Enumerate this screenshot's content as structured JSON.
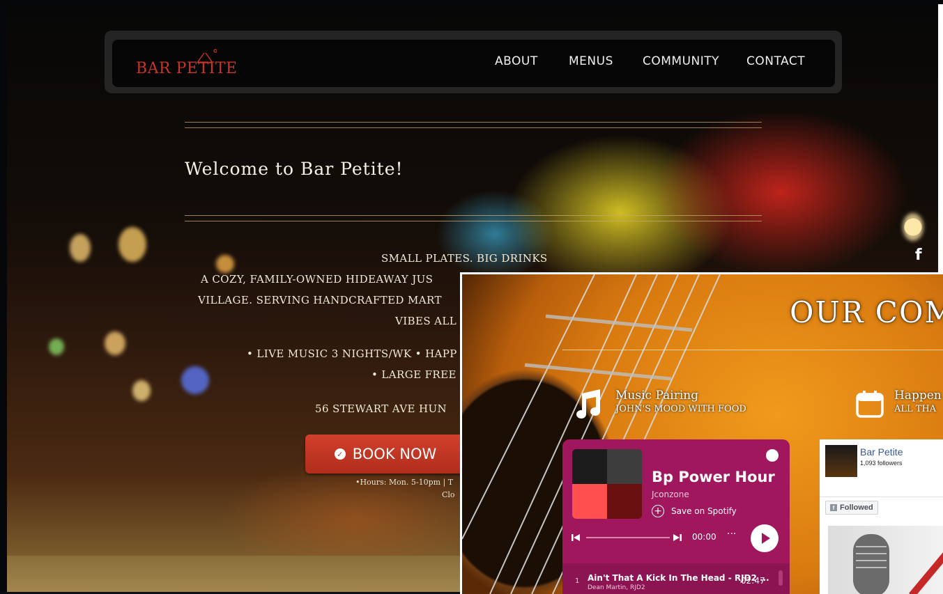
{
  "site": {
    "logo_text": "BAR PETITE",
    "nav": [
      "ABOUT",
      "MENUS",
      "COMMUNITY",
      "CONTACT"
    ],
    "welcome": "Welcome to Bar Petite!",
    "tagline": "SMALL PLATES. BIG DRINKS",
    "desc_line1": "A COZY, FAMILY-OWNED HIDEAWAY JUS",
    "desc_line2": "VILLAGE. SERVING HANDCRAFTED MART",
    "desc_line3": "VIBES ALL",
    "features_line1": "• LIVE MUSIC 3 NIGHTS/WK • HAPP",
    "features_line2": "• LARGE FREE",
    "address": "56 STEWART AVE HUN",
    "book_label": "BOOK NOW",
    "hours_line1": "•Hours: Mon. 5-10pm | T",
    "hours_line2": "Clo",
    "social_icon": "facebook-icon",
    "accent": "#c8342a"
  },
  "community": {
    "heading": "OUR COM",
    "music_title": "Music Pairing",
    "music_sub": "JOHN'S MOOD WITH FOOD",
    "happen_title": "Happen",
    "happen_sub": "ALL THA"
  },
  "spotify": {
    "playlist_title": "Bp Power Hour",
    "owner": "Jconzone",
    "save_label": "Save on Spotify",
    "time": "00:00",
    "track_number": "1",
    "track_title": "Ain't That A Kick In The Head - RJD2 ...",
    "track_artist": "Dean Martin, RJD2",
    "track_time": "02:47",
    "bg_color": "#a0175e"
  },
  "facebook_widget": {
    "page_name": "Bar Petite",
    "followers": "1,093 followers",
    "followed_label": "Followed"
  }
}
